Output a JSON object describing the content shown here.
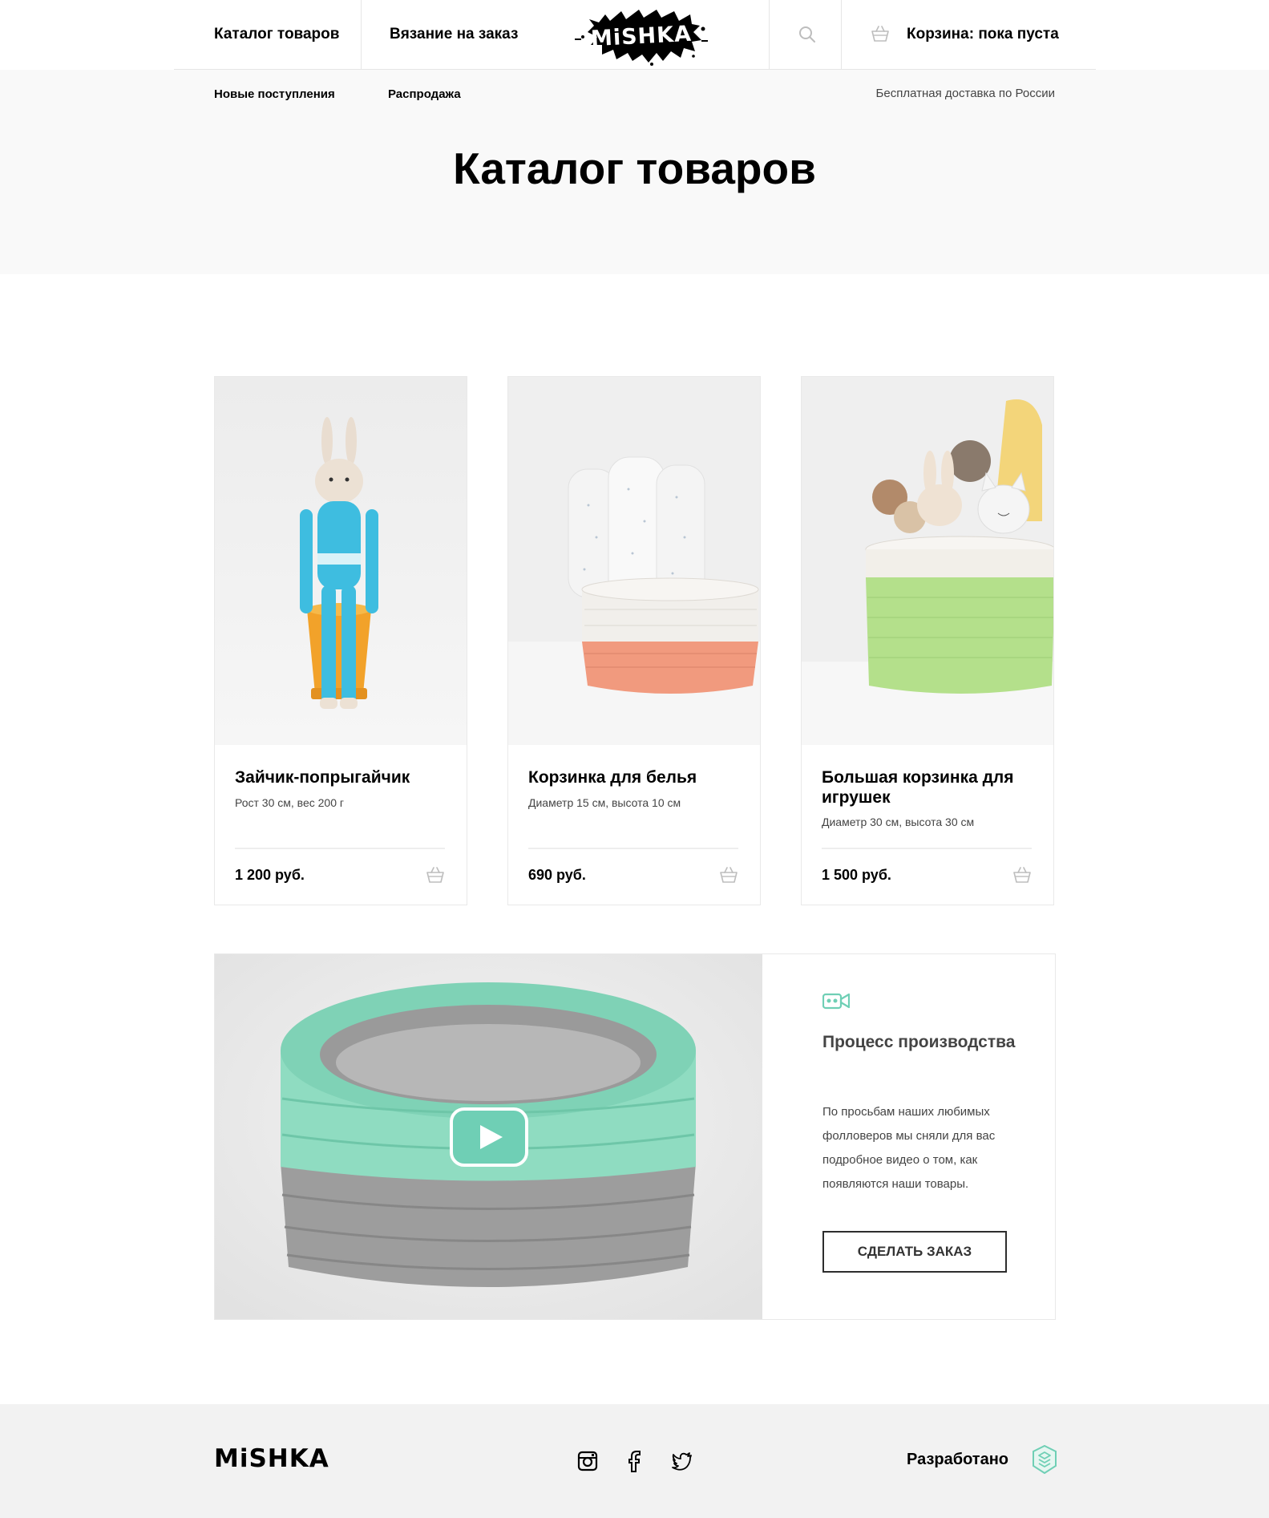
{
  "header": {
    "nav_catalog": "Каталог товаров",
    "nav_knitting": "Вязание на заказ",
    "logo_text": "MiSHKA",
    "cart_label": "Корзина: пока пуста"
  },
  "subnav": {
    "new_arrivals": "Новые поступления",
    "sale": "Распродажа",
    "delivery": "Бесплатная доставка по России"
  },
  "page": {
    "title": "Каталог товаров"
  },
  "products": [
    {
      "title": "Зайчик-попрыгайчик",
      "desc": "Рост 30 см, вес 200 г",
      "price": "1 200 руб."
    },
    {
      "title": "Корзинка для белья",
      "desc": "Диаметр 15 см, высота 10 см",
      "price": "690 руб."
    },
    {
      "title": "Большая корзинка для игрушек",
      "desc": "Диаметр 30 см, высота 30 см",
      "price": "1 500 руб."
    }
  ],
  "video": {
    "title": "Процесс производства",
    "text": "По просьбам наших любимых фолловеров мы сняли для вас подробное видео о том, как появляются наши товары.",
    "button": "Сделать заказ"
  },
  "footer": {
    "logo_text": "MiSHKA",
    "developed_by": "Разработано"
  },
  "colors": {
    "accent": "#6fcfb5",
    "text": "#000000",
    "muted": "#444444",
    "footer_bg": "#f2f2f2",
    "hero_bg": "#f9f9f9"
  }
}
